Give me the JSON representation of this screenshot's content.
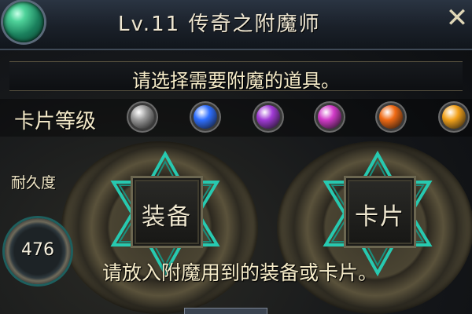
{
  "title": "Lv.11  传奇之附魔师",
  "close_icon": "close-icon",
  "prompt": "请选择需要附魔的道具。",
  "card_level": {
    "label": "卡片等级",
    "gems": [
      {
        "name": "gray",
        "color": "#9a9a9a"
      },
      {
        "name": "blue",
        "color": "#2f6fff"
      },
      {
        "name": "purple",
        "color": "#a13bd6"
      },
      {
        "name": "magenta",
        "color": "#d23bc9"
      },
      {
        "name": "orange",
        "color": "#f06a14"
      },
      {
        "name": "gold",
        "color": "#f3a21b"
      }
    ]
  },
  "durability": {
    "label": "耐久度",
    "value": "476"
  },
  "equipment_slot": {
    "label": "装备"
  },
  "card_slot": {
    "label": "卡片"
  },
  "hint": "请放入附魔用到的装备或卡片。",
  "colors": {
    "accent": "#27c9b0"
  }
}
